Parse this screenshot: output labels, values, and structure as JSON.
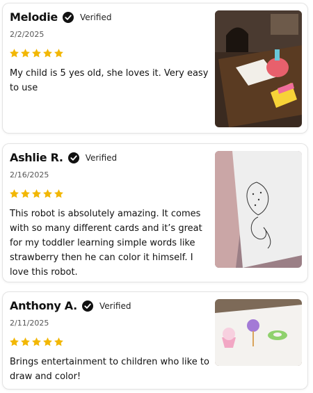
{
  "reviews": [
    {
      "author": "Melodie",
      "verified_label": "Verified",
      "date": "2/2/2025",
      "rating": 5,
      "text": "My child is 5 yes old, she loves it. Very easy to use"
    },
    {
      "author": "Ashlie R.",
      "verified_label": "Verified",
      "date": "2/16/2025",
      "rating": 5,
      "text": "This robot is absolutely amazing. It comes with so many different cards and it’s great for my toddler learning simple words like strawberry then he can color it himself. I love this robot."
    },
    {
      "author": "Anthony A.",
      "verified_label": "Verified",
      "date": "2/11/2025",
      "rating": 5,
      "text": "Brings entertainment to children who like to draw and color!"
    }
  ],
  "icons": {
    "verified": "verified-check-icon",
    "star": "star-icon"
  },
  "colors": {
    "star": "#F2B705",
    "check_badge": "#111111"
  }
}
